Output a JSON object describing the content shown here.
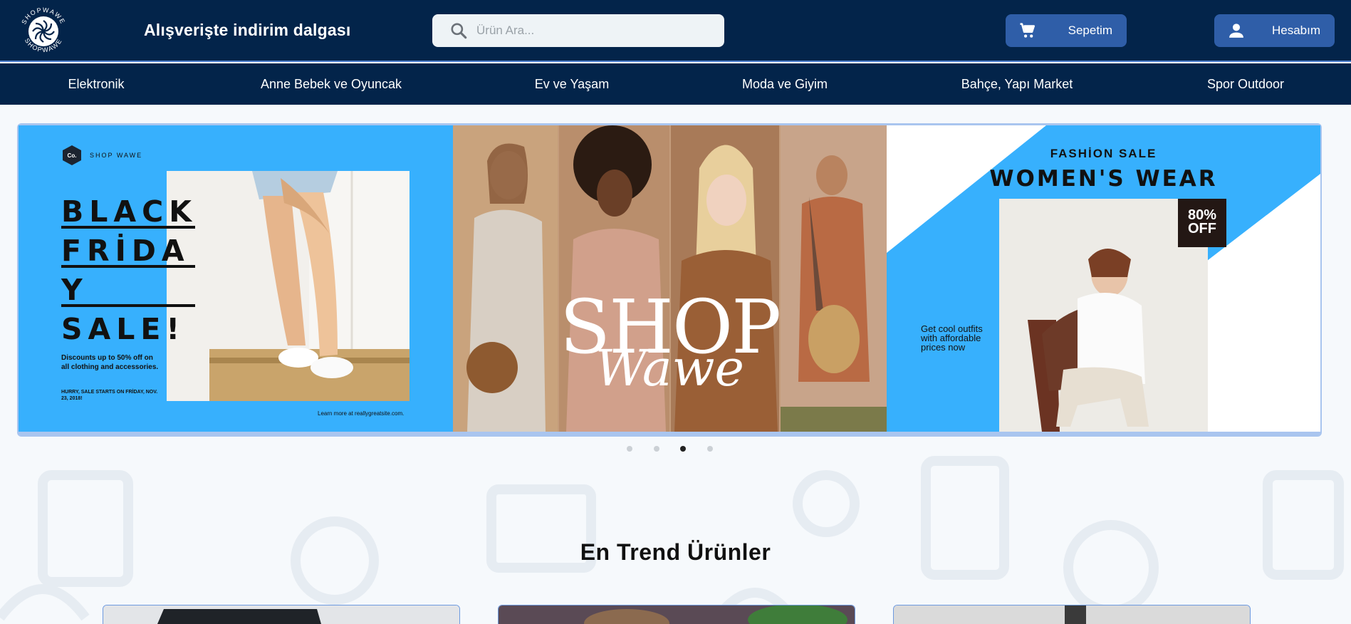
{
  "header": {
    "logo": {
      "text": "SHOPWAWE"
    },
    "slogan": "Alışverişte indirim dalgası",
    "search": {
      "placeholder": "Ürün Ara...",
      "value": "",
      "icon": "search-icon"
    },
    "cart": {
      "label": "Sepetim",
      "icon": "cart-icon"
    },
    "account": {
      "label": "Hesabım",
      "icon": "person-icon"
    }
  },
  "nav": {
    "items": [
      {
        "label": "Elektronik"
      },
      {
        "label": "Anne Bebek ve Oyuncak"
      },
      {
        "label": "Ev ve Yaşam"
      },
      {
        "label": "Moda ve Giyim"
      },
      {
        "label": "Bahçe, Yapı Market"
      },
      {
        "label": "Spor Outdoor"
      }
    ]
  },
  "banner": {
    "slide1": {
      "badge": "Co.",
      "brand": "SHOP WAWE",
      "headline": [
        "BLACK",
        "FRİDA",
        "Y",
        "SALE!"
      ],
      "description": "Discounts up to 50% off on all clothing and accessories.",
      "hurry": "HURRY, SALE STARTS ON FRİDAY, NOV. 23, 2018!",
      "learn_more": "Learn more at reallygreatsite.com."
    },
    "slide2": {
      "title": "SHOP",
      "script": "Wawe"
    },
    "slide3": {
      "kicker": "FASHİON SALE",
      "title": "WOMEN'S WEAR",
      "discount_value": "80%",
      "discount_label": "OFF",
      "tagline": "Get cool outfits with affordable prices  now"
    },
    "dots": {
      "count": 4,
      "active_index": 2
    }
  },
  "section": {
    "title": "En Trend Ürünler"
  },
  "colors": {
    "header_bg": "#03244a",
    "button_bg": "#2f5ea8",
    "banner_blue": "#37b0fd",
    "page_bg": "#f6f9fc"
  }
}
